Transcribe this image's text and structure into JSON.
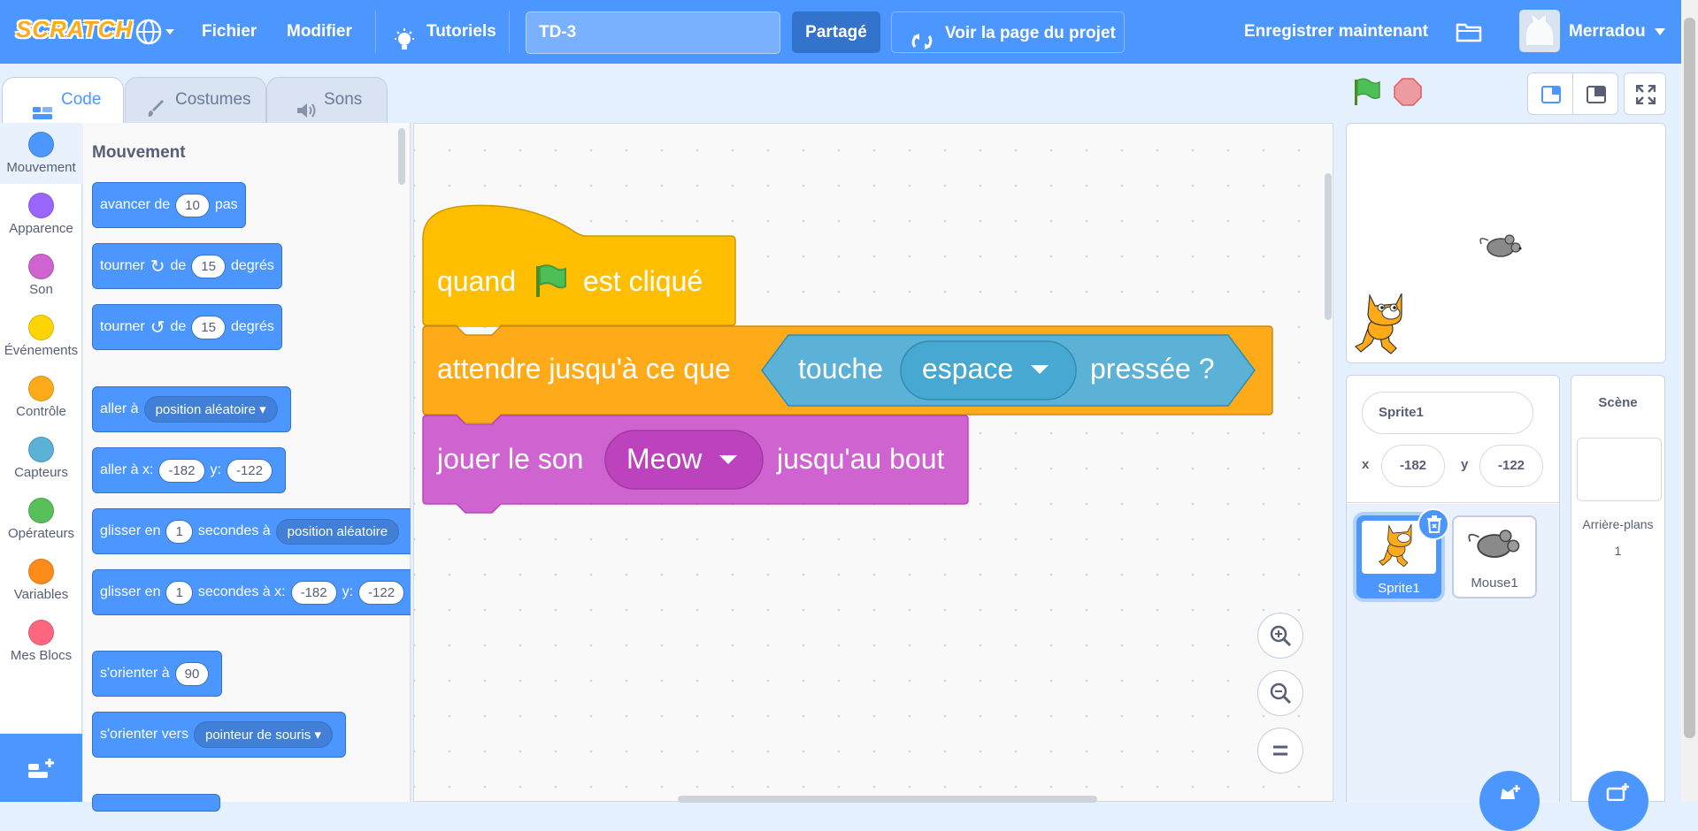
{
  "menu": {
    "logo": "SCRATCH",
    "file": "Fichier",
    "edit": "Modifier",
    "tutorials": "Tutoriels",
    "project_title": "TD-3",
    "share": "Partagé",
    "see_project": "Voir la page du projet",
    "save_now": "Enregistrer maintenant",
    "username": "Merradou"
  },
  "tabs": {
    "code": "Code",
    "costumes": "Costumes",
    "sounds": "Sons"
  },
  "categories": [
    {
      "label": "Mouvement",
      "color": "#4c97ff"
    },
    {
      "label": "Apparence",
      "color": "#9966ff"
    },
    {
      "label": "Son",
      "color": "#cf63cf"
    },
    {
      "label": "Événements",
      "color": "#ffd500"
    },
    {
      "label": "Contrôle",
      "color": "#ffab19"
    },
    {
      "label": "Capteurs",
      "color": "#5cb1d6"
    },
    {
      "label": "Opérateurs",
      "color": "#59c059"
    },
    {
      "label": "Variables",
      "color": "#ff8c1a"
    },
    {
      "label": "Mes Blocs",
      "color": "#ff6680"
    }
  ],
  "palette": {
    "title": "Mouvement",
    "move": {
      "a": "avancer de",
      "v": "10",
      "b": "pas"
    },
    "turn_right": {
      "a": "tourner",
      "b": "de",
      "v": "15",
      "c": "degrés"
    },
    "turn_left": {
      "a": "tourner",
      "b": "de",
      "v": "15",
      "c": "degrés"
    },
    "goto": {
      "a": "aller à",
      "d": "position aléatoire"
    },
    "goto_xy": {
      "a": "aller à x:",
      "x": "-182",
      "b": "y:",
      "y": "-122"
    },
    "glide": {
      "a": "glisser en",
      "v": "1",
      "b": "secondes à",
      "d": "position aléatoire"
    },
    "glide_xy": {
      "a": "glisser en",
      "v": "1",
      "b": "secondes à x:",
      "x": "-182",
      "c": "y:",
      "y": "-122"
    },
    "point_dir": {
      "a": "s'orienter à",
      "v": "90"
    },
    "point_towards": {
      "a": "s'orienter vers",
      "d": "pointeur de souris"
    }
  },
  "script": {
    "hat": {
      "a": "quand",
      "b": "est cliqué"
    },
    "wait": {
      "a": "attendre jusqu'à ce que",
      "b": "touche",
      "key": "espace",
      "c": "pressée ?"
    },
    "play": {
      "a": "jouer le son",
      "sound": "Meow",
      "b": "jusqu'au bout"
    }
  },
  "sprite_info": {
    "name": "Sprite1",
    "x_label": "x",
    "x": "-182",
    "y_label": "y",
    "y": "-122"
  },
  "sprites": [
    {
      "name": "Sprite1",
      "selected": true
    },
    {
      "name": "Mouse1",
      "selected": false
    }
  ],
  "scene": {
    "title": "Scène",
    "backdrops_label": "Arrière-plans",
    "backdrops_count": "1"
  },
  "colors": {
    "motion": "#4c97ff",
    "events": "#ffbf00",
    "control": "#ffab19",
    "sensing": "#5cb1d6",
    "sound": "#cf63cf"
  }
}
